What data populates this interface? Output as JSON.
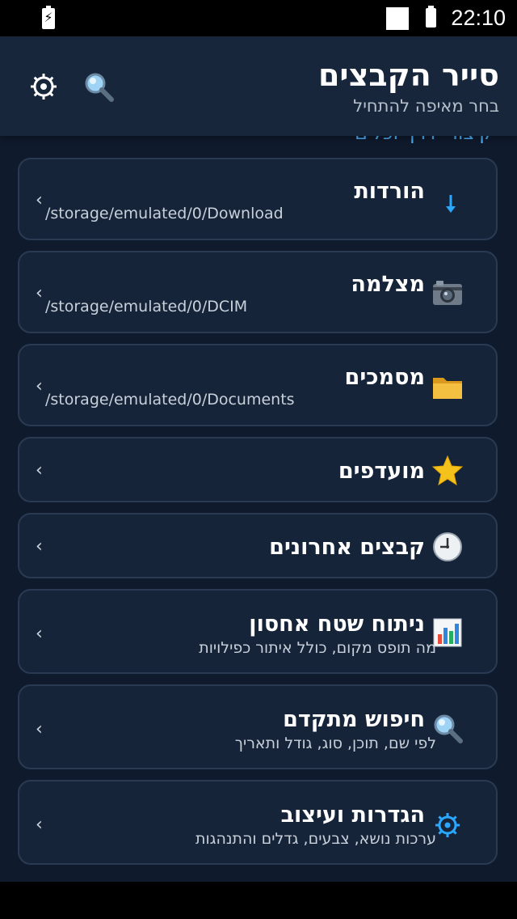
{
  "status_bar": {
    "time": "22:10"
  },
  "header": {
    "title": "סייר הקבצים",
    "subtitle": "בחר מאיפה להתחיל",
    "icons": [
      "gear-icon",
      "search-icon"
    ]
  },
  "section": {
    "label": "קיצורי דרך וכלים"
  },
  "items": [
    {
      "title": "הורדות",
      "path": "/storage/emulated/0/Download",
      "icon": "download-arrow-icon"
    },
    {
      "title": "מצלמה",
      "path": "/storage/emulated/0/DCIM",
      "icon": "camera-icon"
    },
    {
      "title": "מסמכים",
      "path": "/storage/emulated/0/Documents",
      "icon": "folder-icon"
    },
    {
      "title": "מועדפים",
      "icon": "star-icon"
    },
    {
      "title": "קבצים אחרונים",
      "icon": "clock-icon"
    },
    {
      "title": "ניתוח שטח אחסון",
      "desc": "מה תופס מקום, כולל איתור כפילויות",
      "icon": "bar-chart-icon"
    },
    {
      "title": "חיפוש מתקדם",
      "desc": "לפי שם, תוכן, סוג, גודל ותאריך",
      "icon": "magnifier-icon"
    },
    {
      "title": "הגדרות ועיצוב",
      "desc": "ערכות נושא, צבעים, גדלים והתנהגות",
      "icon": "settings-gear-icon"
    }
  ],
  "chevron": "‹"
}
